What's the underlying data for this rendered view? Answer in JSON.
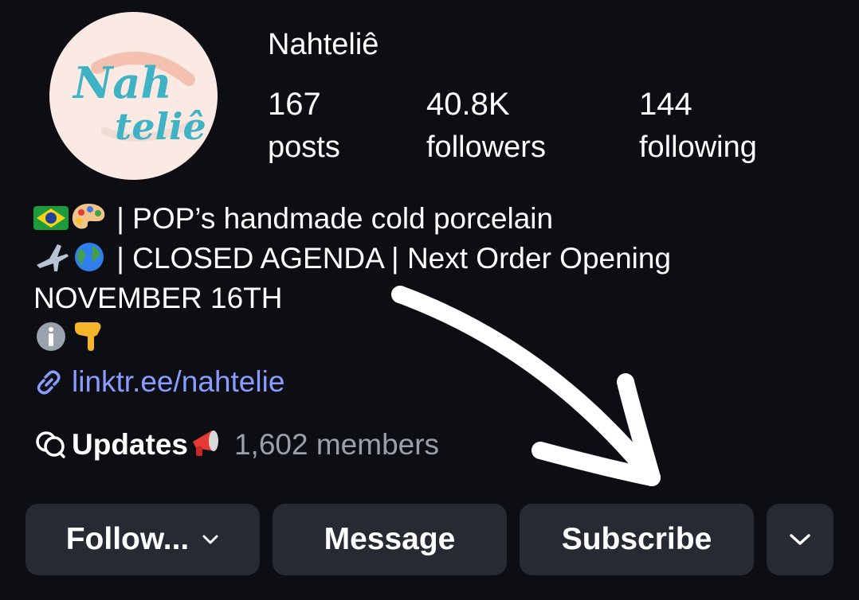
{
  "profile": {
    "username": "Nahteliê",
    "avatar_text_line1": "Nah",
    "avatar_text_line2": "teliê",
    "stats": [
      {
        "value": "167",
        "label": "posts"
      },
      {
        "value": "40.8K",
        "label": "followers"
      },
      {
        "value": "144",
        "label": "following"
      }
    ]
  },
  "bio": {
    "line1_text": "| POP’s handmade cold porcelain",
    "line2_text": "| CLOSED AGENDA | Next Order Opening",
    "line3_text": "NOVEMBER 16TH",
    "line1_icons": [
      "brazil-flag-emoji",
      "artist-palette-emoji"
    ],
    "line2_icons": [
      "airplane-emoji",
      "globe-emoji"
    ],
    "line4_icons": [
      "information-emoji",
      "pointing-down-emoji"
    ]
  },
  "link": {
    "text": "linktr.ee/nahtelie",
    "icon": "link-icon",
    "color": "#8a9cff"
  },
  "channel": {
    "name": "Updates",
    "icon": "broadcast-channel-icon",
    "emoji": "megaphone-emoji",
    "members": "1,602 members"
  },
  "actions": {
    "follow_label": "Follow...",
    "message_label": "Message",
    "subscribe_label": "Subscribe",
    "more_icon": "chevron-down-icon"
  },
  "colors": {
    "background": "#0d0e13",
    "button": "#262a33",
    "avatar_bg": "#fbe9e4",
    "avatar_text": "#3fb3c4"
  }
}
